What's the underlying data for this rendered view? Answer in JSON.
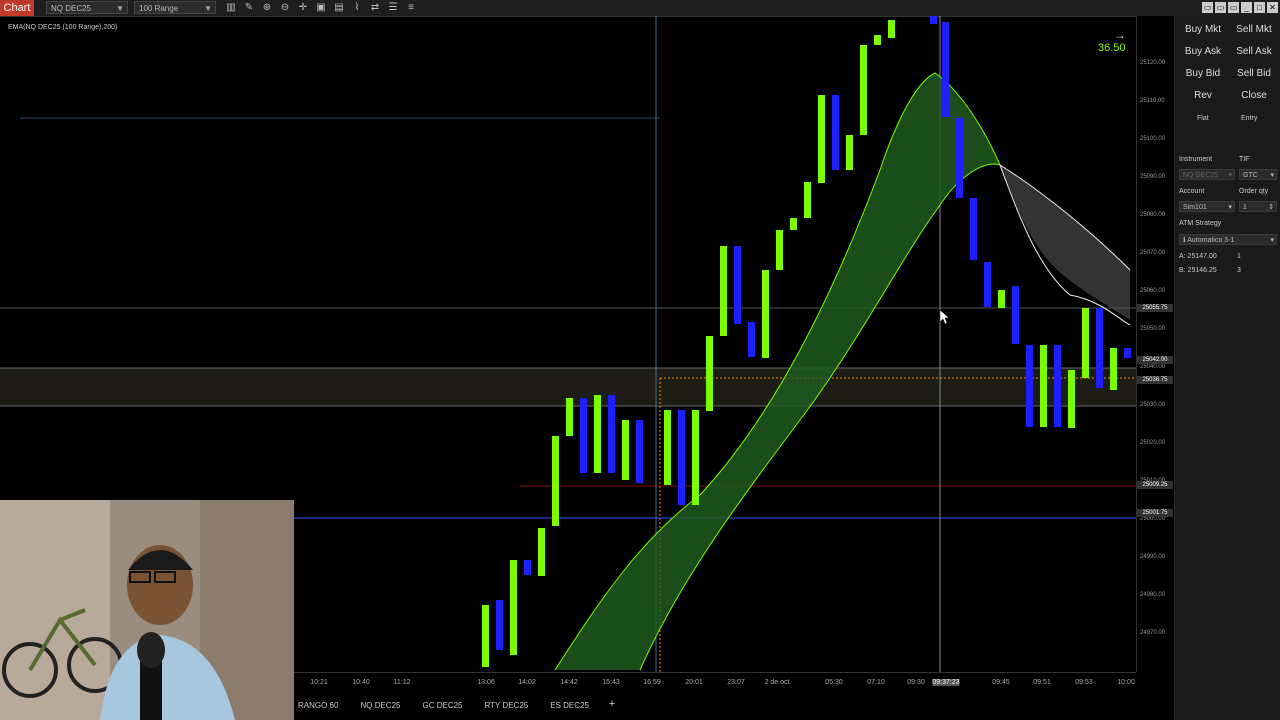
{
  "toolbar": {
    "chart_tab": "Chart",
    "instrument": "NQ DEC25",
    "interval": "100 Range"
  },
  "indicator_label": "EMA(NQ DEC25 (100 Range),200)",
  "countdown": "36.50",
  "price_axis": {
    "labels": [
      "25120.00",
      "25110.00",
      "25100.00",
      "25090.00",
      "25080.00",
      "25070.00",
      "25060.00",
      "25050.00",
      "25040.00",
      "25030.00",
      "25020.00",
      "25010.00",
      "25000.00",
      "24990.00",
      "24980.00",
      "24970.00"
    ],
    "tags": [
      {
        "text": "25055.75",
        "color": "#444"
      },
      {
        "text": "25042.00",
        "color": "#444"
      },
      {
        "text": "25036.75",
        "color": "#444"
      },
      {
        "text": "25009.25",
        "color": "#444"
      },
      {
        "text": "25001.75",
        "color": "#444"
      }
    ]
  },
  "time_axis": {
    "labels": [
      "10:21",
      "10:40",
      "11:12",
      "13:06",
      "14:02",
      "14:42",
      "15:43",
      "16:59",
      "20:01",
      "23:07",
      "2 de oct.",
      "05:30",
      "07:10",
      "09:30",
      "09:37:23",
      "09:45",
      "09:51",
      "09:53",
      "10:00"
    ]
  },
  "bottom_tabs": [
    "RANGO 60",
    "NQ DEC25",
    "GC DEC25",
    "RTY DEC25",
    "ES DEC25"
  ],
  "right_panel": {
    "buy_mkt": "Buy Mkt",
    "sell_mkt": "Sell Mkt",
    "buy_ask": "Buy Ask",
    "sell_ask": "Sell Ask",
    "buy_bid": "Buy Bid",
    "sell_bid": "Sell Bid",
    "rev": "Rev",
    "close": "Close",
    "flat": "Flat",
    "entry": "Entry",
    "instrument_label": "Instrument",
    "tif_label": "TIF",
    "instrument_value": "NQ DEC25",
    "tif_value": "GTC",
    "account_label": "Account",
    "order_qty_label": "Order qty",
    "account_value": "Sim101",
    "order_qty_value": "1",
    "atm_label": "ATM Strategy",
    "atm_value": "Automatico 3-1",
    "ask_line": "A: 25147.00",
    "ask_qty": "1",
    "bid_line": "B: 25146.25",
    "bid_qty": "3"
  },
  "colors": {
    "up_candle": "#7CFC00",
    "down_candle": "#1E1EFF",
    "ribbon": "#2e7d32",
    "brand": "#c0392b"
  }
}
